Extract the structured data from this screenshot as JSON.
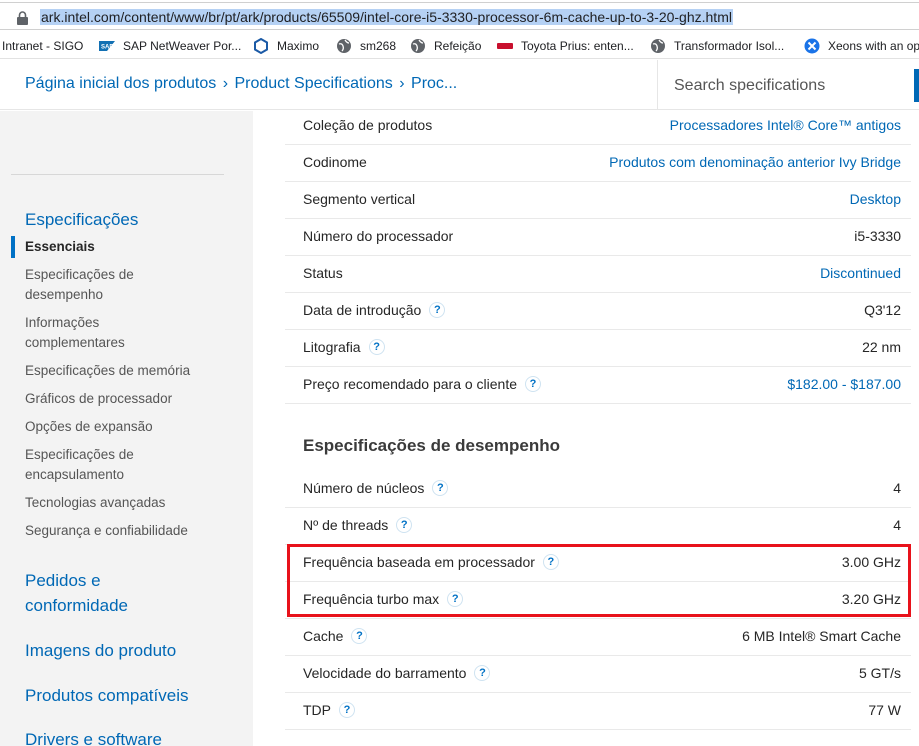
{
  "browser": {
    "url": "ark.intel.com/content/www/br/pt/ark/products/65509/intel-core-i5-3330-processor-6m-cache-up-to-3-20-ghz.html"
  },
  "bookmarks": [
    {
      "label": "Intranet - SIGO",
      "icon": "none"
    },
    {
      "label": "SAP NetWeaver Por...",
      "icon": "sap-logo-icon"
    },
    {
      "label": "Maximo",
      "icon": "maximo-icon"
    },
    {
      "label": "sm268",
      "icon": "globe-icon"
    },
    {
      "label": "Refeição",
      "icon": "globe-icon"
    },
    {
      "label": "Toyota Prius: enten...",
      "icon": "brand-favicon-icon"
    },
    {
      "label": "Transformador Isol...",
      "icon": "globe-icon"
    },
    {
      "label": "Xeons with an op",
      "icon": "xeons-favicon-icon"
    }
  ],
  "header": {
    "crumbs": [
      "Página inicial dos produtos",
      "Product Specifications",
      "Proc..."
    ],
    "separator": "›",
    "search_placeholder": "Search specifications"
  },
  "sidebar": {
    "heading": "Especificações",
    "items": [
      "Essenciais",
      "Especificações de desempenho",
      "Informações complementares",
      "Especificações de memória",
      "Gráficos de processador",
      "Opções de expansão",
      "Especificações de encapsulamento",
      "Tecnologias avançadas",
      "Segurança e confiabilidade"
    ],
    "links": [
      "Pedidos e conformidade",
      "Imagens do produto",
      "Produtos compatíveis",
      "Drivers e software"
    ]
  },
  "essentials": [
    {
      "label": "Coleção de produtos",
      "value": "Processadores Intel® Core™ antigos",
      "link": true,
      "help": false
    },
    {
      "label": "Codinome",
      "value": "Produtos com denominação anterior Ivy Bridge",
      "link": true,
      "help": false
    },
    {
      "label": "Segmento vertical",
      "value": "Desktop",
      "link": true,
      "help": false
    },
    {
      "label": "Número do processador",
      "value": "i5-3330",
      "link": false,
      "help": false
    },
    {
      "label": "Status",
      "value": "Discontinued",
      "link": true,
      "help": false
    },
    {
      "label": "Data de introdução",
      "value": "Q3'12",
      "link": false,
      "help": true
    },
    {
      "label": "Litografia",
      "value": "22 nm",
      "link": false,
      "help": true
    },
    {
      "label": "Preço recomendado para o cliente",
      "value": "$182.00 - $187.00",
      "link": true,
      "help": true
    }
  ],
  "performance_title": "Especificações de desempenho",
  "performance": [
    {
      "label": "Número de núcleos",
      "value": "4",
      "help": true
    },
    {
      "label": "Nº de threads",
      "value": "4",
      "help": true
    },
    {
      "label": "Frequência baseada em processador",
      "value": "3.00 GHz",
      "help": true
    },
    {
      "label": "Frequência turbo max",
      "value": "3.20 GHz",
      "help": true
    },
    {
      "label": "Cache",
      "value": "6 MB Intel® Smart Cache",
      "help": true
    },
    {
      "label": "Velocidade do barramento",
      "value": "5 GT/s",
      "help": true
    },
    {
      "label": "TDP",
      "value": "77 W",
      "help": true
    }
  ],
  "help_glyph": "?",
  "colors": {
    "link": "#0068b5",
    "highlight": "#e8121b",
    "sidebar_bg": "#f3f3f3"
  }
}
